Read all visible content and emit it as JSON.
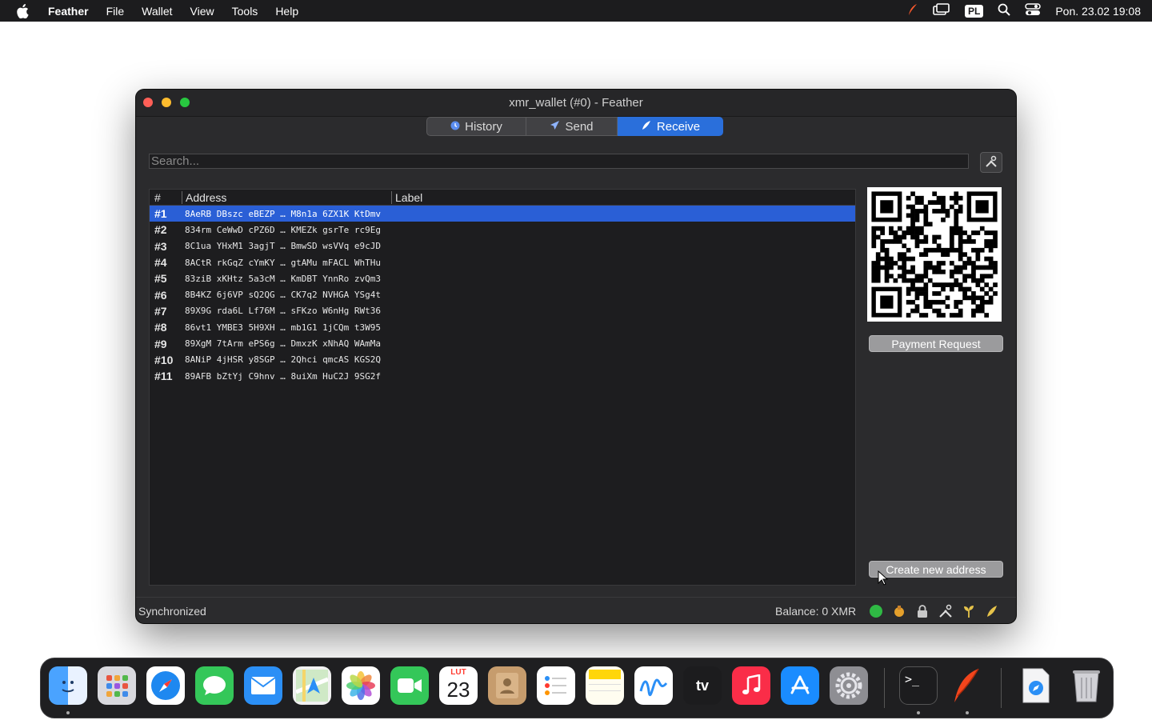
{
  "menubar": {
    "app_name": "Feather",
    "items": [
      "File",
      "Wallet",
      "View",
      "Tools",
      "Help"
    ],
    "input_badge": "PL",
    "datetime": "Pon. 23.02  19:08"
  },
  "window": {
    "title": "xmr_wallet (#0) - Feather",
    "tabs": [
      {
        "label": "History",
        "icon": "history-icon"
      },
      {
        "label": "Send",
        "icon": "send-icon"
      },
      {
        "label": "Receive",
        "icon": "receive-icon",
        "active": true
      }
    ],
    "search_placeholder": "Search...",
    "table": {
      "headers": [
        "#",
        "Address",
        "Label"
      ],
      "rows": [
        {
          "num": "#1",
          "address": "8AeRB DBszc eBEZP … M8n1a 6ZX1K KtDmv",
          "label": "",
          "selected": true
        },
        {
          "num": "#2",
          "address": "834rm CeWwD cPZ6D … KMEZk gsrTe rc9Eg",
          "label": ""
        },
        {
          "num": "#3",
          "address": "8C1ua YHxM1 3agjT … BmwSD wsVVq e9cJD",
          "label": ""
        },
        {
          "num": "#4",
          "address": "8ACtR rkGqZ cYmKY … gtAMu mFACL WhTHu",
          "label": ""
        },
        {
          "num": "#5",
          "address": "83ziB xKHtz 5a3cM … KmDBT YnnRo zvQm3",
          "label": ""
        },
        {
          "num": "#6",
          "address": "8B4KZ 6j6VP sQ2QG … CK7q2 NVHGA YSg4t",
          "label": ""
        },
        {
          "num": "#7",
          "address": "89X9G rda6L Lf76M … sFKzo W6nHg RWt36",
          "label": ""
        },
        {
          "num": "#8",
          "address": "86vt1 YMBE3 5H9XH … mb1G1 1jCQm t3W95",
          "label": ""
        },
        {
          "num": "#9",
          "address": "89XgM 7tArm ePS6g … DmxzK xNhAQ WAmMa",
          "label": ""
        },
        {
          "num": "#10",
          "address": "8ANiP 4jHSR y8SGP … 2Qhci qmcAS KGS2Q",
          "label": ""
        },
        {
          "num": "#11",
          "address": "89AFB bZtYj C9hnv … 8uiXm HuC2J 9SG2f",
          "label": ""
        }
      ]
    },
    "payment_request_label": "Payment Request",
    "create_address_label": "Create new address",
    "status": "Synchronized",
    "balance": "Balance: 0 XMR"
  },
  "dock": {
    "apps": [
      "finder",
      "launchpad",
      "safari",
      "messages",
      "mail",
      "maps",
      "photos",
      "facetime",
      "calendar",
      "contacts",
      "reminders",
      "notes",
      "freeform",
      "tv",
      "music",
      "app-store",
      "system-settings",
      "terminal",
      "feather",
      "downloads",
      "trash"
    ],
    "calendar_month": "LUT",
    "calendar_day": "23"
  },
  "colors": {
    "accent": "#2a6fdb",
    "selected_row": "#2a5fd6",
    "window_bg": "#2b2b2d",
    "menubar_bg": "#1c1c1e"
  }
}
